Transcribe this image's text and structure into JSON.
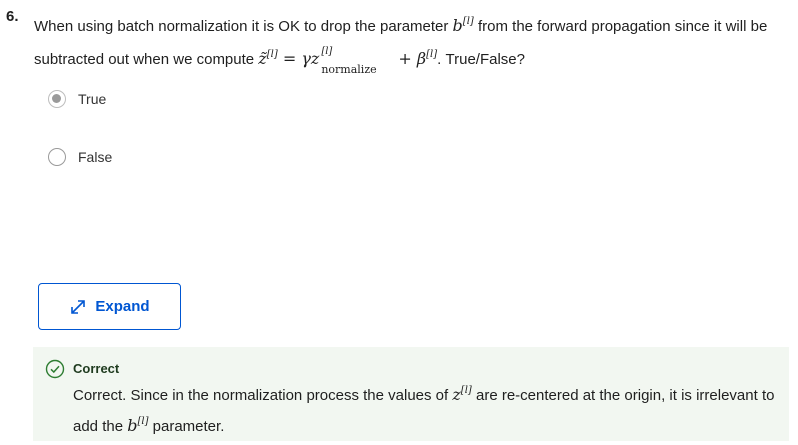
{
  "question": {
    "number": "6.",
    "text_part1": "When using batch normalization it is OK to drop the parameter ",
    "param_b": "b",
    "param_b_sup": "[l]",
    "text_part2": " from the forward propagation since it will be subtracted out when we compute ",
    "z_tilde": "z̃",
    "z_tilde_sup": "[l]",
    "equals": " = ",
    "gamma": "γ",
    "z": "z",
    "z_sup": "[l]",
    "z_sub": "normalize",
    "plus": " + ",
    "beta": "β",
    "beta_sup": "[l]",
    "text_part3": ". True/False?"
  },
  "options": [
    {
      "label": "True",
      "selected": true
    },
    {
      "label": "False",
      "selected": false
    }
  ],
  "expand_button": {
    "label": "Expand",
    "icon": "expand-arrows-icon"
  },
  "feedback": {
    "status": "Correct",
    "text_part1": "Correct. Since in the normalization process the values of ",
    "z": "z",
    "z_sup": "[l]",
    "text_part2": " are re-centered at the origin, it is irrelevant to add the ",
    "b": "b",
    "b_sup": "[l]",
    "text_part3": " parameter.",
    "colors": {
      "background": "#f2f7f1",
      "check": "#2e7d32"
    }
  },
  "colors": {
    "accent": "#0056d2"
  }
}
